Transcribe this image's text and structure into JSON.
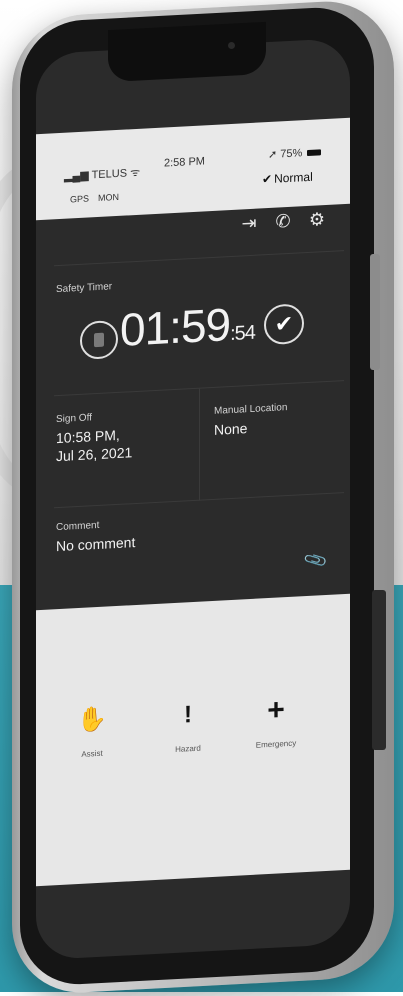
{
  "status_bar": {
    "carrier": "TELUS",
    "time": "2:58 PM",
    "battery": "75%",
    "gps": "GPS",
    "mon": "MON",
    "mode": "Normal"
  },
  "toolbar": {
    "icons": [
      "sign-out-icon",
      "phone-icon",
      "settings-icon"
    ]
  },
  "timer": {
    "label": "Safety Timer",
    "time": "01:59",
    "seconds": ":54"
  },
  "sign_off": {
    "label": "Sign Off",
    "line1": "10:58 PM,",
    "line2": "Jul 26, 2021"
  },
  "manual_location": {
    "label": "Manual Location",
    "value": "None"
  },
  "comment": {
    "label": "Comment",
    "value": "No comment"
  },
  "actions": {
    "assist": "Assist",
    "hazard": "Hazard",
    "emergency": "Emergency"
  }
}
